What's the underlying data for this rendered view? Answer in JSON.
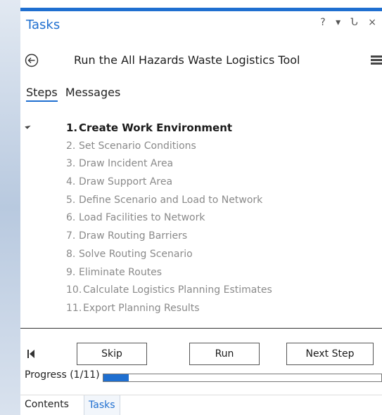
{
  "pane": {
    "title": "Tasks",
    "controls": {
      "help": "?",
      "dropdown": "▾",
      "pin": "Ն",
      "close": "×"
    }
  },
  "task": {
    "title": "Run the All Hazards Waste Logistics Tool"
  },
  "tabs": [
    {
      "label": "Steps",
      "active": true
    },
    {
      "label": "Messages",
      "active": false
    }
  ],
  "steps": [
    {
      "num": "1.",
      "label": "Create Work Environment"
    },
    {
      "num": "2.",
      "label": "Set Scenario Conditions"
    },
    {
      "num": "3.",
      "label": "Draw Incident Area"
    },
    {
      "num": "4.",
      "label": "Draw Support Area"
    },
    {
      "num": "5.",
      "label": "Define Scenario and Load to Network"
    },
    {
      "num": "6.",
      "label": "Load Facilities to Network"
    },
    {
      "num": "7.",
      "label": "Draw Routing Barriers"
    },
    {
      "num": "8.",
      "label": "Solve Routing Scenario"
    },
    {
      "num": "9.",
      "label": "Eliminate Routes"
    },
    {
      "num": "10.",
      "label": "Calculate Logistics Planning Estimates"
    },
    {
      "num": "11.",
      "label": "Export Planning Results"
    }
  ],
  "buttons": {
    "skip": "Skip",
    "run": "Run",
    "next": "Next Step"
  },
  "progress": {
    "label": "Progress (1/11)",
    "current": 1,
    "total": 11
  },
  "bottom_tabs": [
    {
      "label": "Contents",
      "active": false
    },
    {
      "label": "Tasks",
      "active": true
    }
  ],
  "colors": {
    "accent": "#1f6fd0",
    "muted_text": "#8a8a8a"
  },
  "icons": {
    "back": "back-circle-arrow-icon",
    "menu": "hamburger-menu-icon",
    "first": "go-to-first-icon",
    "collapse": "collapse-triangle-icon"
  }
}
